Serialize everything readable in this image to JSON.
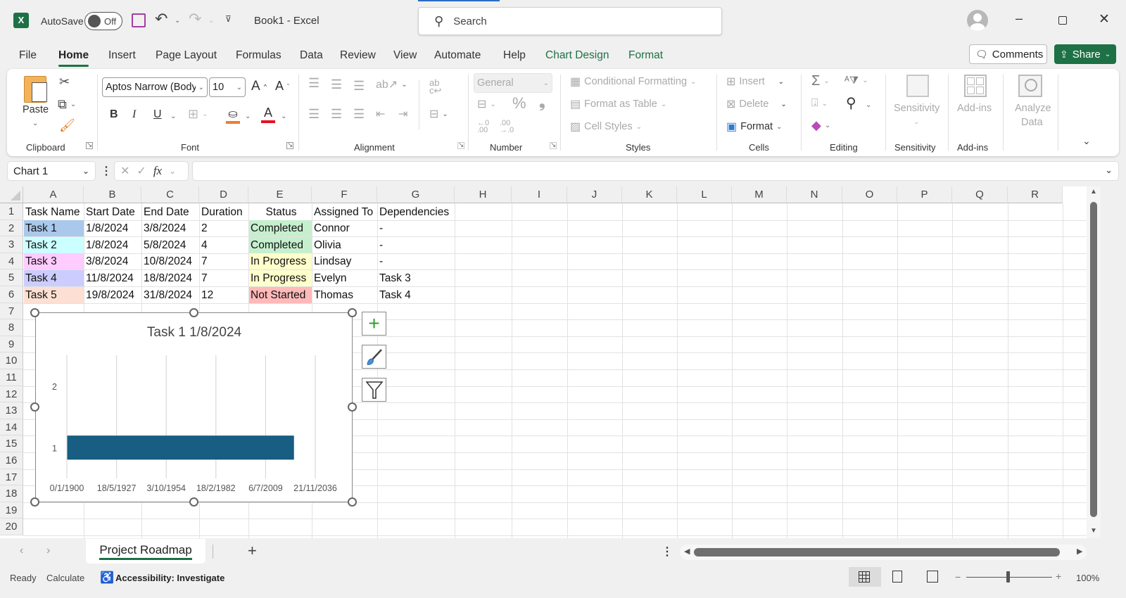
{
  "titlebar": {
    "autosave_label": "AutoSave",
    "autosave_state": "Off",
    "doc_title": "Book1  -  Excel",
    "search_placeholder": "Search"
  },
  "menu": {
    "tabs": [
      {
        "label": "File"
      },
      {
        "label": "Home",
        "active": true
      },
      {
        "label": "Insert"
      },
      {
        "label": "Page Layout"
      },
      {
        "label": "Formulas"
      },
      {
        "label": "Data"
      },
      {
        "label": "Review"
      },
      {
        "label": "View"
      },
      {
        "label": "Automate"
      },
      {
        "label": "Help"
      },
      {
        "label": "Chart Design",
        "contextual": true
      },
      {
        "label": "Format",
        "contextual": true
      }
    ],
    "comments_label": "Comments",
    "share_label": "Share"
  },
  "ribbon": {
    "clipboard": {
      "paste_label": "Paste",
      "group_label": "Clipboard"
    },
    "font": {
      "font_name": "Aptos Narrow (Body)",
      "font_size": "10",
      "group_label": "Font",
      "bold": "B",
      "italic": "I",
      "underline": "U"
    },
    "alignment": {
      "group_label": "Alignment"
    },
    "number": {
      "format": "General",
      "group_label": "Number"
    },
    "styles": {
      "conditional_formatting": "Conditional Formatting",
      "format_as_table": "Format as Table",
      "cell_styles": "Cell Styles",
      "group_label": "Styles"
    },
    "cells": {
      "insert": "Insert",
      "delete": "Delete",
      "format": "Format",
      "group_label": "Cells"
    },
    "editing": {
      "group_label": "Editing"
    },
    "sensitivity": {
      "label": "Sensitivity",
      "group_label": "Sensitivity"
    },
    "addins": {
      "label": "Add-ins",
      "group_label": "Add-ins"
    },
    "analyze": {
      "label1": "Analyze",
      "label2": "Data"
    }
  },
  "formula_bar": {
    "name_box": "Chart 1",
    "fx": "fx",
    "formula": ""
  },
  "grid": {
    "columns": [
      "A",
      "B",
      "C",
      "D",
      "E",
      "F",
      "G",
      "H",
      "I",
      "J",
      "K",
      "L",
      "M",
      "N",
      "O",
      "P",
      "Q",
      "R"
    ],
    "rows": [
      "1",
      "2",
      "3",
      "4",
      "5",
      "6",
      "7",
      "8",
      "9",
      "10",
      "11",
      "12",
      "13",
      "14",
      "15",
      "16",
      "17",
      "18",
      "19",
      "20"
    ],
    "headers": [
      "Task Name",
      "Start Date",
      "End Date",
      "Duration",
      "Status",
      "Assigned To",
      "Dependencies"
    ],
    "data": [
      [
        "Task 1",
        "1/8/2024",
        "3/8/2024",
        "2",
        "Completed",
        "Connor",
        "-"
      ],
      [
        "Task 2",
        "1/8/2024",
        "5/8/2024",
        "4",
        "Completed",
        "Olivia",
        "-"
      ],
      [
        "Task 3",
        "3/8/2024",
        "10/8/2024",
        "7",
        "In Progress",
        "Lindsay",
        "-"
      ],
      [
        "Task 4",
        "11/8/2024",
        "18/8/2024",
        "7",
        "In Progress",
        "Evelyn",
        "Task 3"
      ],
      [
        "Task 5",
        "19/8/2024",
        "31/8/2024",
        "12",
        "Not Started",
        "Thomas",
        "Task 4"
      ]
    ],
    "task_colors": [
      "#a9c8ec",
      "#ccffff",
      "#ffccff",
      "#ccccff",
      "#fde0d3"
    ],
    "status_colors": {
      "Completed": "#c6efce",
      "In Progress": "#ffffcc",
      "Not Started": "#ffb9b9"
    }
  },
  "chart_data": {
    "type": "bar",
    "orientation": "horizontal",
    "title": "Task 1 1/8/2024",
    "categories": [
      "1",
      "2"
    ],
    "series": [
      {
        "name": "Task 1 1/8/2024",
        "values": [
          45505,
          null
        ],
        "color": "#175e82"
      }
    ],
    "x_tick_labels": [
      "0/1/1900",
      "18/5/1927",
      "3/10/1954",
      "18/2/1982",
      "6/7/2009",
      "21/11/2036"
    ],
    "xlim": [
      0,
      50000
    ],
    "x_major_unit": 10000,
    "grid": true,
    "legend": "none",
    "xlabel": "",
    "ylabel": ""
  },
  "sheets": {
    "tabs": [
      {
        "label": "Project Roadmap",
        "active": true
      }
    ],
    "add_label": "+"
  },
  "status": {
    "ready": "Ready",
    "calculate": "Calculate",
    "accessibility": "Accessibility: Investigate",
    "zoom": "100%",
    "zoom_level": 1.0
  }
}
